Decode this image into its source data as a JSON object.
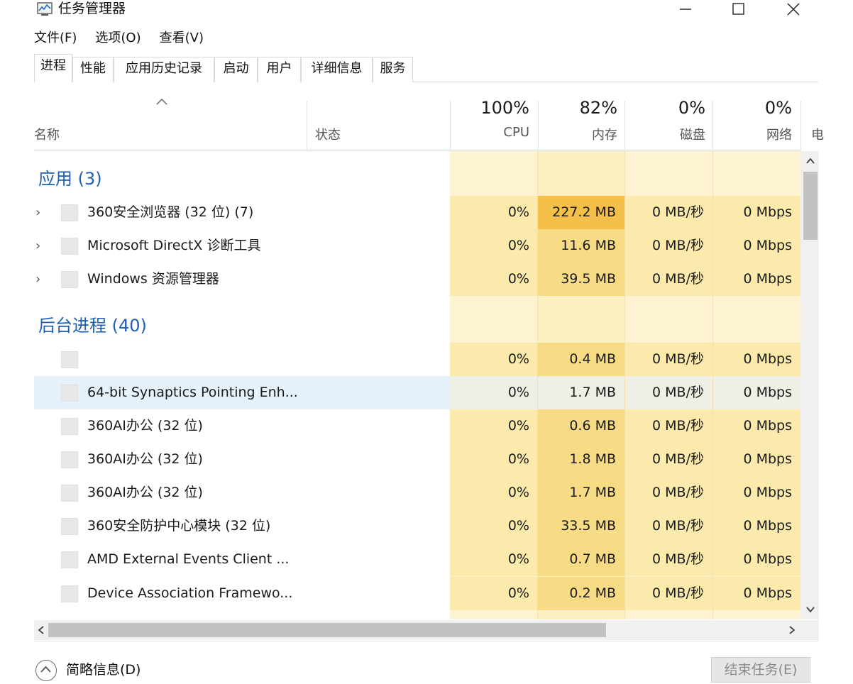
{
  "window": {
    "title": "任务管理器",
    "min_icon": "minimize-icon",
    "max_icon": "maximize-icon",
    "close_icon": "close-icon"
  },
  "menu": [
    "文件(F)",
    "选项(O)",
    "查看(V)"
  ],
  "tabs": [
    "进程",
    "性能",
    "应用历史记录",
    "启动",
    "用户",
    "详细信息",
    "服务"
  ],
  "header": {
    "name": "名称",
    "status": "状态",
    "cpu_pct": "100%",
    "cpu": "CPU",
    "mem_pct": "82%",
    "mem": "内存",
    "disk_pct": "0%",
    "disk": "磁盘",
    "net_pct": "0%",
    "net": "网络",
    "cut_col": "电"
  },
  "groups": {
    "apps": "应用 (3)",
    "background": "后台进程 (40)"
  },
  "apps": [
    {
      "name": "360安全浏览器 (32 位) (7)",
      "cpu": "0%",
      "mem": "227.2 MB",
      "disk": "0 MB/秒",
      "net": "0 Mbps"
    },
    {
      "name": "Microsoft DirectX 诊断工具",
      "cpu": "0%",
      "mem": "11.6 MB",
      "disk": "0 MB/秒",
      "net": "0 Mbps"
    },
    {
      "name": "Windows 资源管理器",
      "cpu": "0%",
      "mem": "39.5 MB",
      "disk": "0 MB/秒",
      "net": "0 Mbps"
    }
  ],
  "background": [
    {
      "name": "",
      "cpu": "0%",
      "mem": "0.4 MB",
      "disk": "0 MB/秒",
      "net": "0 Mbps"
    },
    {
      "name": "64-bit Synaptics Pointing Enh...",
      "cpu": "0%",
      "mem": "1.7 MB",
      "disk": "0 MB/秒",
      "net": "0 Mbps"
    },
    {
      "name": "360AI办公 (32 位)",
      "cpu": "0%",
      "mem": "0.6 MB",
      "disk": "0 MB/秒",
      "net": "0 Mbps"
    },
    {
      "name": "360AI办公 (32 位)",
      "cpu": "0%",
      "mem": "1.8 MB",
      "disk": "0 MB/秒",
      "net": "0 Mbps"
    },
    {
      "name": "360AI办公 (32 位)",
      "cpu": "0%",
      "mem": "1.7 MB",
      "disk": "0 MB/秒",
      "net": "0 Mbps"
    },
    {
      "name": "360安全防护中心模块 (32 位)",
      "cpu": "0%",
      "mem": "33.5 MB",
      "disk": "0 MB/秒",
      "net": "0 Mbps"
    },
    {
      "name": "AMD External Events Client ...",
      "cpu": "0%",
      "mem": "0.7 MB",
      "disk": "0 MB/秒",
      "net": "0 Mbps"
    },
    {
      "name": "Device Association Framewo...",
      "cpu": "0%",
      "mem": "0.2 MB",
      "disk": "0 MB/秒",
      "net": "0 Mbps"
    }
  ],
  "footer": {
    "less_details": "简略信息(D)",
    "end_task": "结束任务(E)"
  },
  "colors": {
    "accent": "#1f5fb4",
    "mem_hot": "#f5c04a",
    "mem_cell": "#f8dc85",
    "cell": "#fbeaab",
    "selected": "#e5f1fb"
  }
}
